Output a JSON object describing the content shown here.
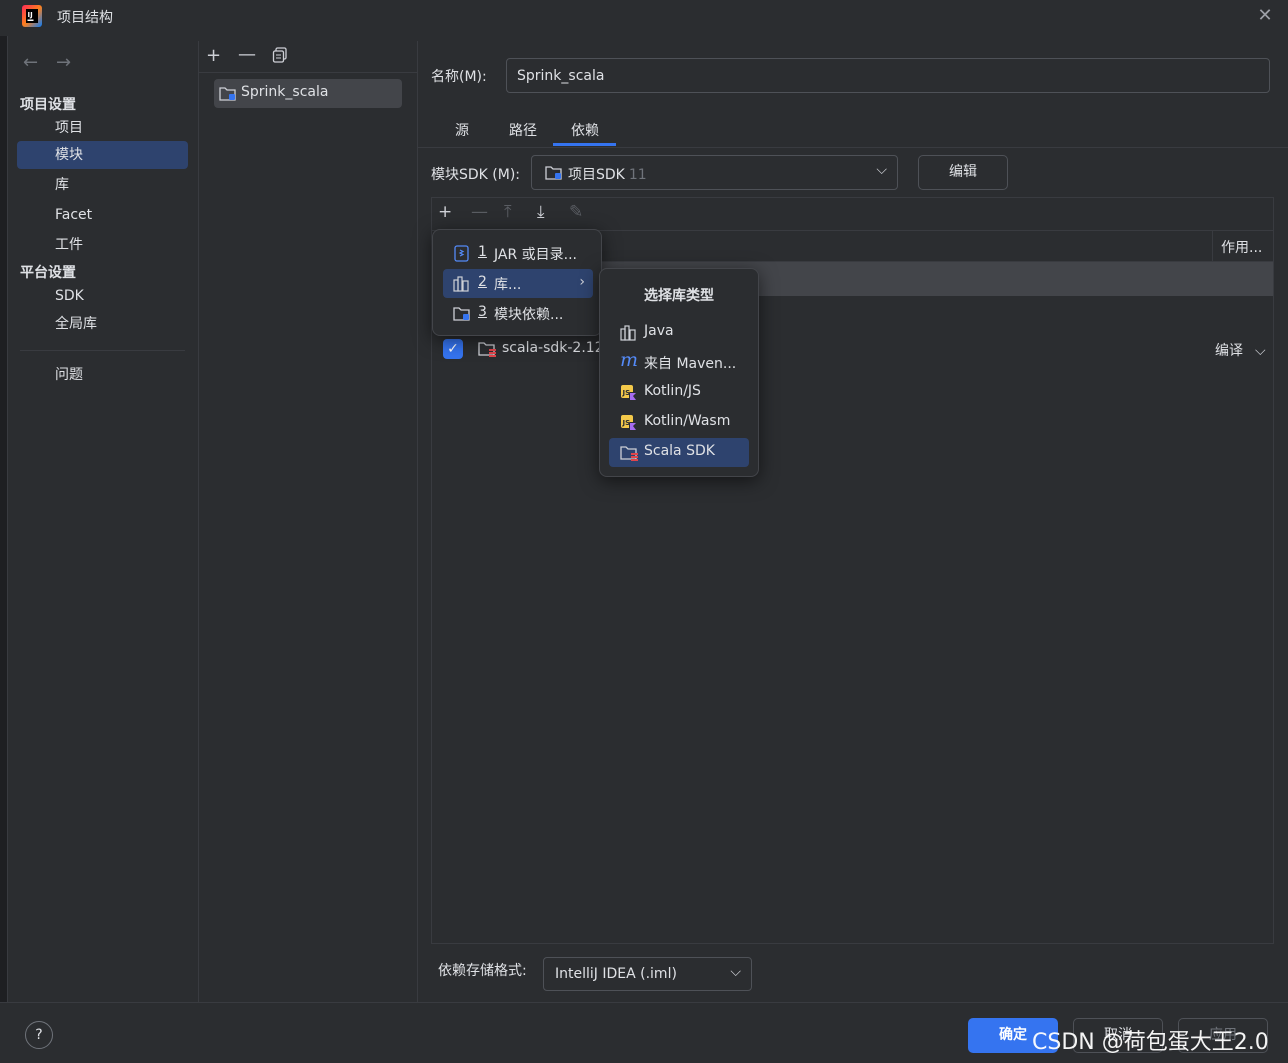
{
  "window": {
    "title": "项目结构",
    "close_glyph": "✕"
  },
  "sidebar": {
    "project_settings_title": "项目设置",
    "project_settings_items": [
      {
        "label": "项目",
        "selected": false
      },
      {
        "label": "模块",
        "selected": true
      },
      {
        "label": "库",
        "selected": false
      },
      {
        "label": "Facet",
        "selected": false
      },
      {
        "label": "工件",
        "selected": false
      }
    ],
    "platform_settings_title": "平台设置",
    "platform_settings_items": [
      {
        "label": "SDK"
      },
      {
        "label": "全局库"
      }
    ],
    "problems_label": "问题"
  },
  "modules": {
    "items": [
      {
        "label": "Sprink_scala"
      }
    ]
  },
  "module_detail": {
    "name_label": "名称(M):",
    "name_value": "Sprink_scala",
    "tabs": [
      {
        "label": "源",
        "active": false
      },
      {
        "label": "路径",
        "active": false
      },
      {
        "label": "依赖",
        "active": true
      }
    ],
    "sdk_label": "模块SDK (M):",
    "sdk_value": "项目SDK",
    "sdk_version": "11",
    "edit_button": "编辑",
    "scope_header": "作用...",
    "dependencies": [
      {
        "name": "scala-sdk-2.12",
        "checked": true,
        "scope": "编译"
      }
    ],
    "storage_label": "依赖存储格式:",
    "storage_value": "IntelliJ IDEA (.iml)"
  },
  "add_menu": {
    "items": [
      {
        "mnemonic": "1",
        "label": "JAR 或目录...",
        "icon": "jar-icon",
        "selected": false
      },
      {
        "mnemonic": "2",
        "label": "库...",
        "icon": "library-icon",
        "selected": true,
        "submenu": true
      },
      {
        "mnemonic": "3",
        "label": "模块依赖...",
        "icon": "module-icon",
        "selected": false
      }
    ]
  },
  "library_type_menu": {
    "title": "选择库类型",
    "items": [
      {
        "label": "Java",
        "icon": "library-icon",
        "selected": false
      },
      {
        "label": "来自 Maven...",
        "icon": "maven-icon",
        "selected": false
      },
      {
        "label": "Kotlin/JS",
        "icon": "kotlin-js-icon",
        "selected": false
      },
      {
        "label": "Kotlin/Wasm",
        "icon": "kotlin-wasm-icon",
        "selected": false
      },
      {
        "label": "Scala SDK",
        "icon": "scala-sdk-icon",
        "selected": true
      }
    ]
  },
  "footer": {
    "help": "?",
    "ok": "确定",
    "cancel": "取消",
    "apply": "应用",
    "watermark": "CSDN @荷包蛋大王2.0"
  },
  "colors": {
    "background": "#2b2d30",
    "selection": "#2e436e",
    "accent": "#3574f0",
    "text": "#dfe1e5",
    "muted": "#6f737a"
  }
}
